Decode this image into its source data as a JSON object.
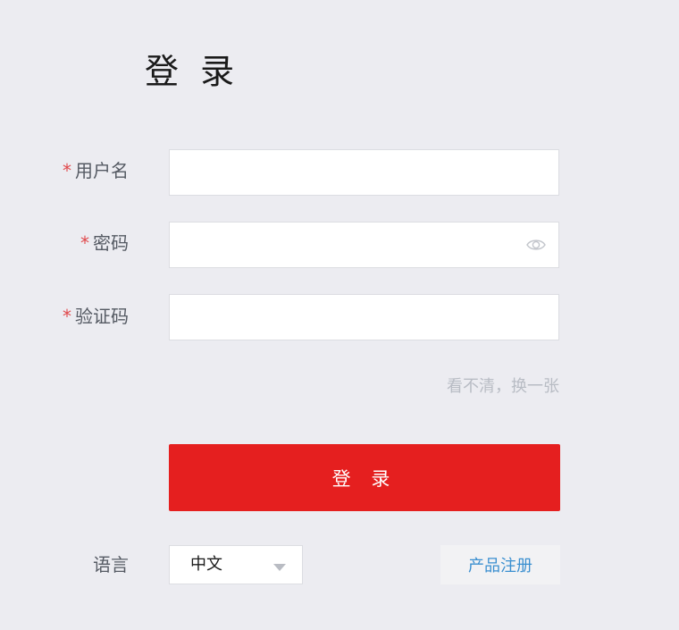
{
  "page": {
    "title": "登 录"
  },
  "form": {
    "required_mark": "*",
    "username": {
      "label": "用户名",
      "value": "",
      "placeholder": ""
    },
    "password": {
      "label": "密码",
      "value": "",
      "placeholder": "",
      "toggle_icon": "eye-icon"
    },
    "captcha": {
      "label": "验证码",
      "value": "",
      "placeholder": "",
      "refresh_text": "看不清，换一张"
    },
    "submit_label": "登 录"
  },
  "footer": {
    "language_label": "语言",
    "language_selected": "中文",
    "register_label": "产品注册"
  },
  "colors": {
    "background": "#ececf1",
    "primary": "#e51f1f",
    "required": "#e0484b",
    "link": "#3a8fd0",
    "muted": "#b8bcc4"
  }
}
